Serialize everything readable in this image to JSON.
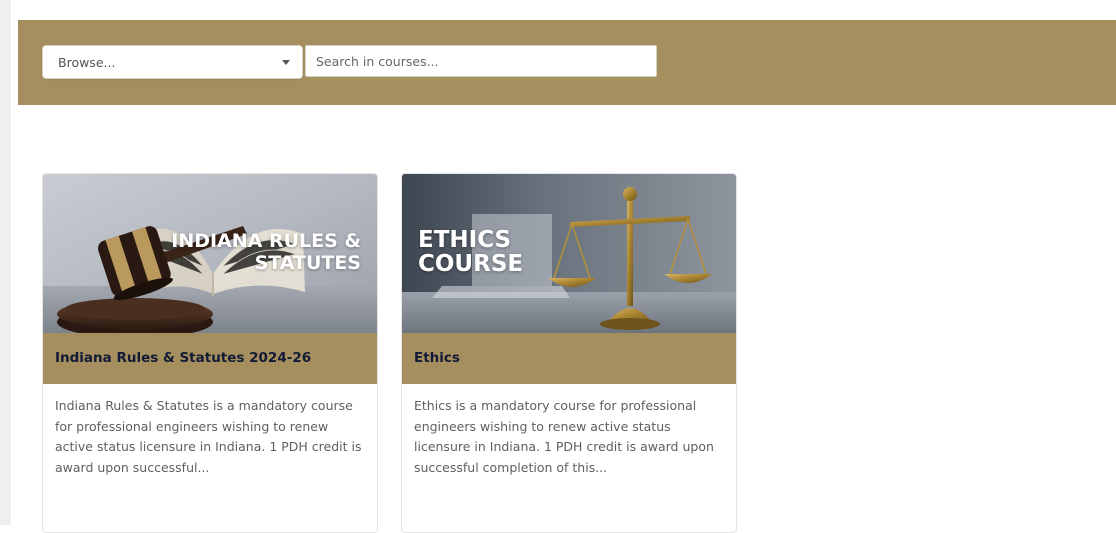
{
  "filters": {
    "browse_label": "Browse...",
    "search_placeholder": "Search in courses..."
  },
  "courses": [
    {
      "image_text_line1": "INDIANA RULES &",
      "image_text_line2": "STATUTES",
      "title": "Indiana Rules & Statutes 2024-26",
      "description": "Indiana Rules & Statutes is a mandatory course for professional engineers wishing to renew active status licensure in Indiana. 1 PDH credit is award upon successful..."
    },
    {
      "image_text_line1": "ETHICS",
      "image_text_line2": "COURSE",
      "title": "Ethics",
      "description": "Ethics is a mandatory course for professional engineers wishing to renew active status licensure in Indiana. 1 PDH credit is award upon successful completion of this..."
    }
  ],
  "colors": {
    "brand_gold": "#a58f5e",
    "title_navy": "#121a36"
  }
}
